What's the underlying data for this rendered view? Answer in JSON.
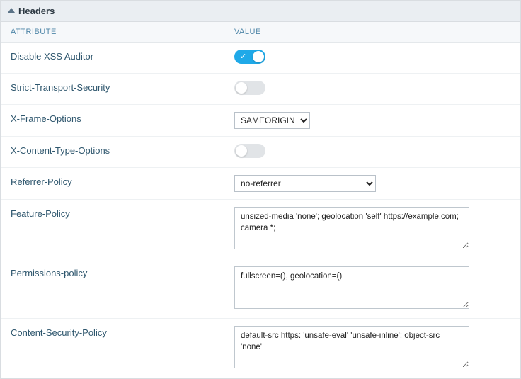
{
  "panel": {
    "title": "Headers"
  },
  "columns": {
    "attribute": "ATTRIBUTE",
    "value": "VALUE"
  },
  "rows": {
    "xss": {
      "label": "Disable XSS Auditor",
      "on": true
    },
    "hsts": {
      "label": "Strict-Transport-Security",
      "on": false
    },
    "xframe": {
      "label": "X-Frame-Options",
      "selected": "SAMEORIGIN"
    },
    "xcto": {
      "label": "X-Content-Type-Options",
      "on": false
    },
    "referrer": {
      "label": "Referrer-Policy",
      "selected": "no-referrer"
    },
    "feature": {
      "label": "Feature-Policy",
      "text": "unsized-media 'none'; geolocation 'self' https://example.com; camera *;"
    },
    "permissions": {
      "label": "Permissions-policy",
      "text": "fullscreen=(), geolocation=()"
    },
    "csp": {
      "label": "Content-Security-Policy",
      "text": "default-src https: 'unsafe-eval' 'unsafe-inline'; object-src 'none'"
    }
  }
}
